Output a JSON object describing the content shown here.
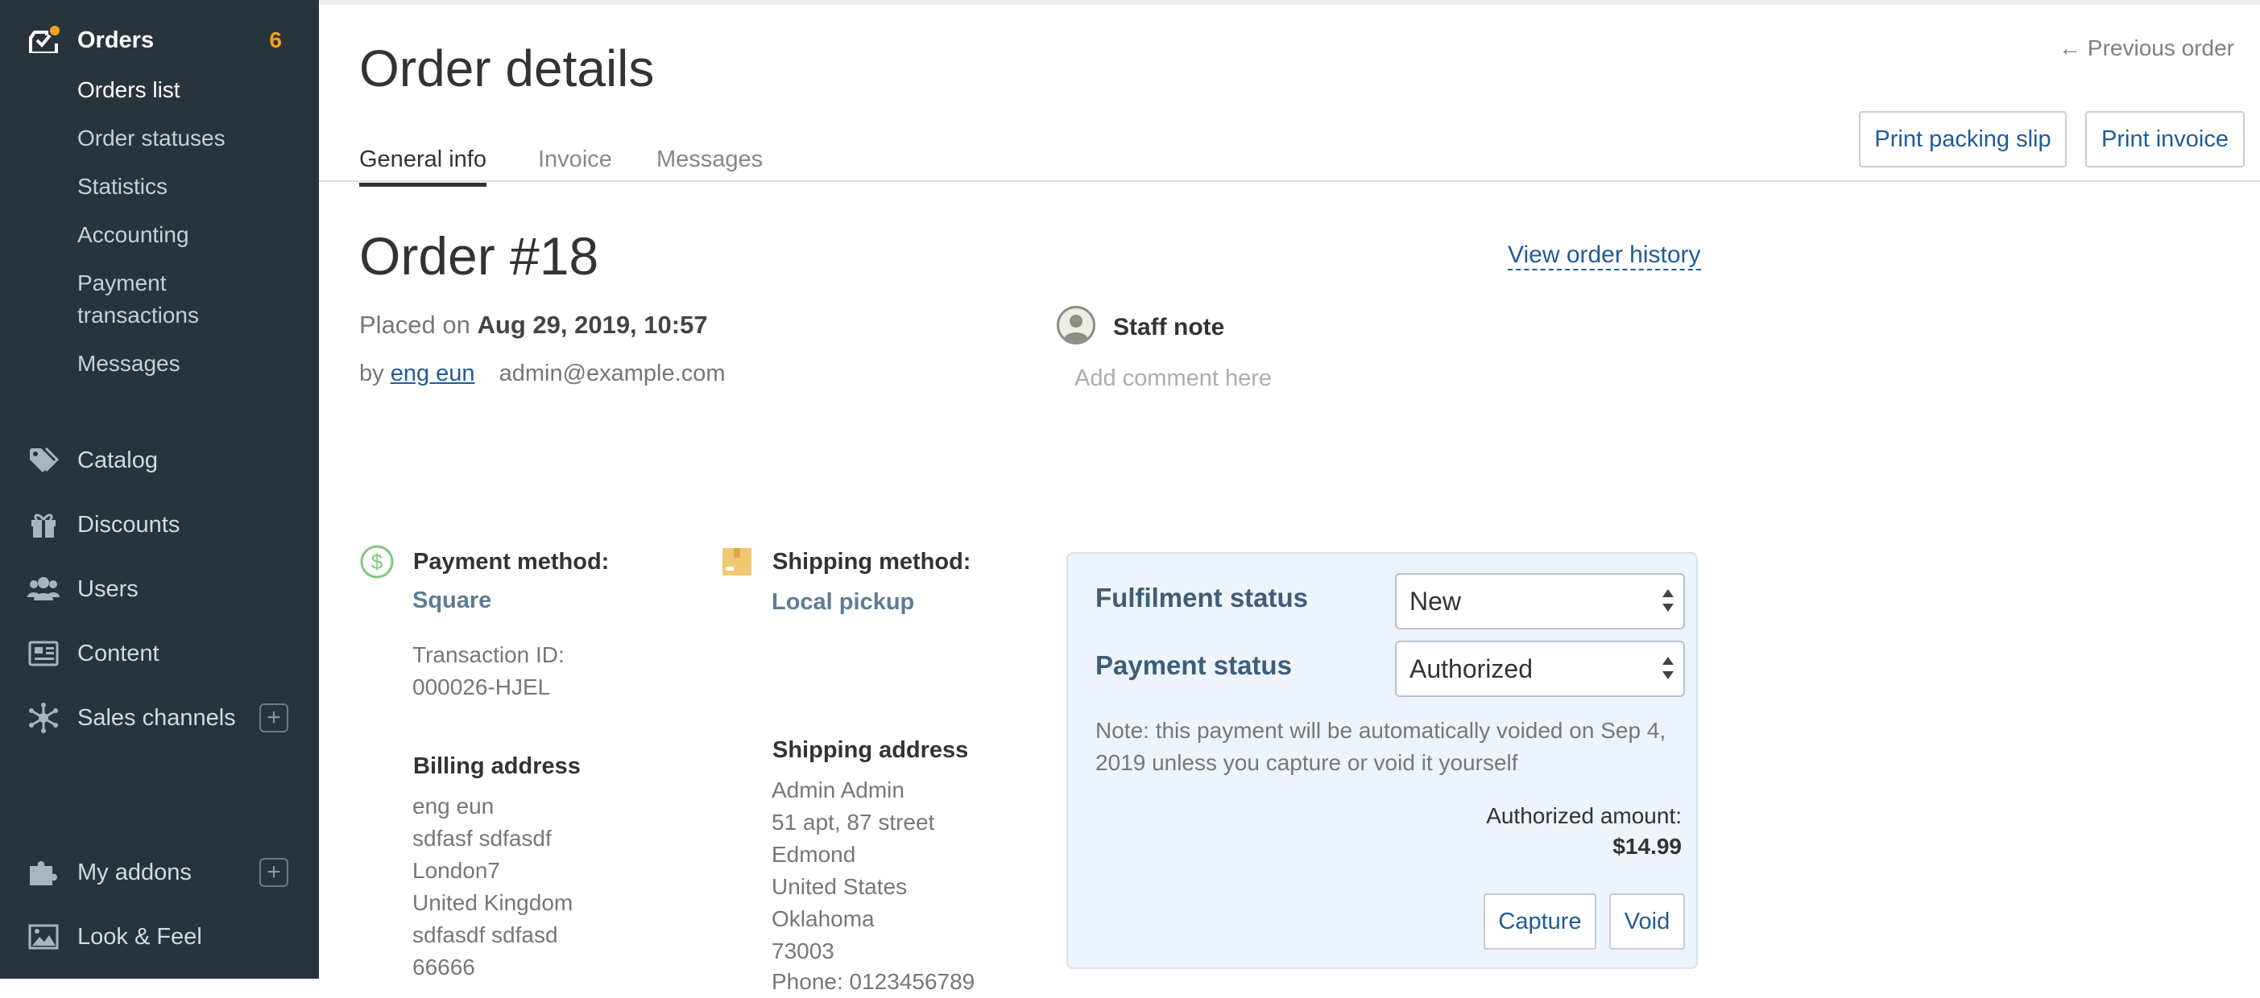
{
  "sidebar": {
    "orders": {
      "label": "Orders",
      "badge": "6"
    },
    "orders_sub": [
      "Orders list",
      "Order statuses",
      "Statistics",
      "Accounting",
      "Payment transactions",
      "Messages"
    ],
    "catalog": "Catalog",
    "discounts": "Discounts",
    "users": "Users",
    "content": "Content",
    "sales_channels": "Sales channels",
    "my_addons": "My addons",
    "look_feel": "Look & Feel",
    "plus": "+"
  },
  "header": {
    "title": "Order details",
    "prev_order": "← Previous order",
    "print_packing_slip": "Print packing slip",
    "print_invoice": "Print invoice",
    "tabs": [
      "General info",
      "Invoice",
      "Messages"
    ]
  },
  "order": {
    "title": "Order #18",
    "placed_prefix": "Placed on",
    "placed_date": "Aug 29, 2019, 10:57",
    "by_prefix": "by",
    "customer_name": "eng eun",
    "customer_email": "admin@example.com",
    "view_history": "View order history",
    "staff_note_label": "Staff note",
    "staff_note_placeholder": "Add comment here"
  },
  "payment": {
    "label": "Payment method:",
    "method": "Square",
    "transaction_label": "Transaction ID:",
    "transaction_id": "000026-HJEL"
  },
  "shipping": {
    "label": "Shipping method:",
    "method": "Local pickup"
  },
  "billing_address": {
    "label": "Billing address",
    "lines": [
      "eng eun",
      "sdfasf sdfasdf",
      "London7",
      "United Kingdom",
      "sdfasdf sdfasd",
      "66666"
    ]
  },
  "shipping_address": {
    "label": "Shipping address",
    "lines": [
      "Admin Admin",
      "51 apt, 87 street",
      "Edmond",
      "United States",
      "Oklahoma",
      "73003",
      "Phone: 0123456789"
    ]
  },
  "status": {
    "fulfilment_label": "Fulfilment status",
    "fulfilment_value": "New",
    "payment_label": "Payment status",
    "payment_value": "Authorized",
    "note": "Note: this payment will be automatically voided on Sep 4, 2019 unless you capture or void it yourself",
    "authorized_label": "Authorized amount:",
    "authorized_amount": "$14.99",
    "capture": "Capture",
    "void": "Void"
  },
  "colors": {
    "sidebar_bg": "#27343c",
    "accent_link": "#1f5c99",
    "badge": "#f7a21b",
    "panel_bg": "#edf4fb"
  }
}
